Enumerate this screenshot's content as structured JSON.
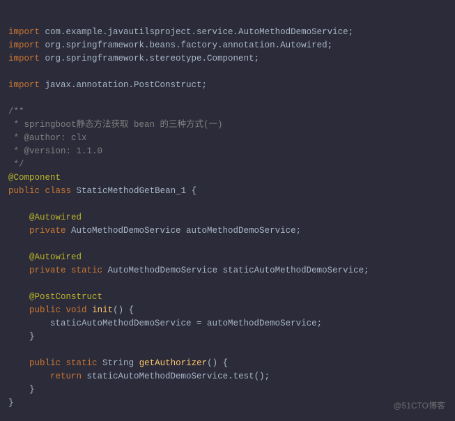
{
  "code": {
    "import1_kw": "import",
    "import1_pkg": " com.example.javautilsproject.service.AutoMethodDemoService;",
    "import2_kw": "import",
    "import2_pkg": " org.springframework.beans.factory.annotation.Autowired;",
    "import3_kw": "import",
    "import3_pkg": " org.springframework.stereotype.Component;",
    "import4_kw": "import",
    "import4_pkg": " javax.annotation.PostConstruct;",
    "comment_open": "/**",
    "comment_l1": " * springboot静态方法获取 bean 的三种方式(一)",
    "comment_l2": " * @author: clx",
    "comment_l3": " * @version: 1.1.0",
    "comment_close": " */",
    "anno_component": "@Component",
    "cls_public": "public",
    "cls_class": "class",
    "cls_name": " StaticMethodGetBean_1 {",
    "anno_autowired1": "    @Autowired",
    "field1_private": "    private",
    "field1_rest": " AutoMethodDemoService autoMethodDemoService;",
    "anno_autowired2": "    @Autowired",
    "field2_private": "    private",
    "field2_static": "static",
    "field2_rest": " AutoMethodDemoService staticAutoMethodDemoService;",
    "anno_postconstruct": "    @PostConstruct",
    "init_public": "    public",
    "init_void": "void",
    "init_name": "init",
    "init_paren": "() {",
    "init_body": "        staticAutoMethodDemoService = autoMethodDemoService;",
    "init_close": "    }",
    "ga_public": "    public",
    "ga_static": "static",
    "ga_type": " String ",
    "ga_name": "getAuthorizer",
    "ga_paren": "() {",
    "ga_return": "        return",
    "ga_expr": " staticAutoMethodDemoService.test();",
    "ga_close": "    }",
    "cls_close": "}"
  },
  "watermark": "@51CTO博客"
}
